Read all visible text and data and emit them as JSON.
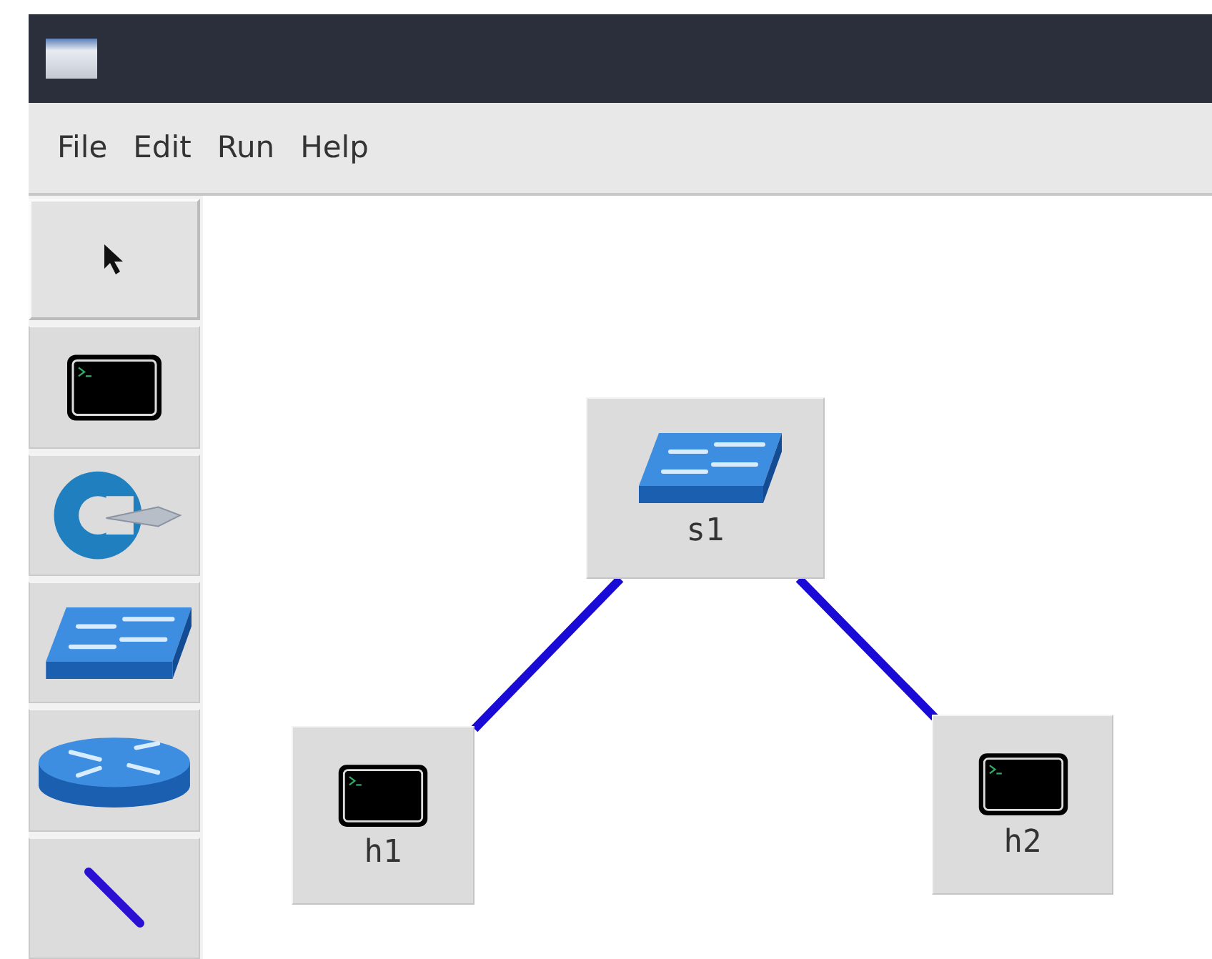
{
  "menu": [
    "File",
    "Edit",
    "Run",
    "Help"
  ],
  "tools": [
    {
      "kind": "select",
      "selected": true
    },
    {
      "kind": "host",
      "selected": false
    },
    {
      "kind": "controller",
      "selected": false
    },
    {
      "kind": "switch",
      "selected": false
    },
    {
      "kind": "router",
      "selected": false
    },
    {
      "kind": "link",
      "selected": false
    }
  ],
  "nodes": [
    {
      "kind": "switch",
      "label": "s1"
    },
    {
      "kind": "host",
      "label": "h1",
      "linked": true
    },
    {
      "kind": "host",
      "label": "h2",
      "linked": true
    }
  ]
}
